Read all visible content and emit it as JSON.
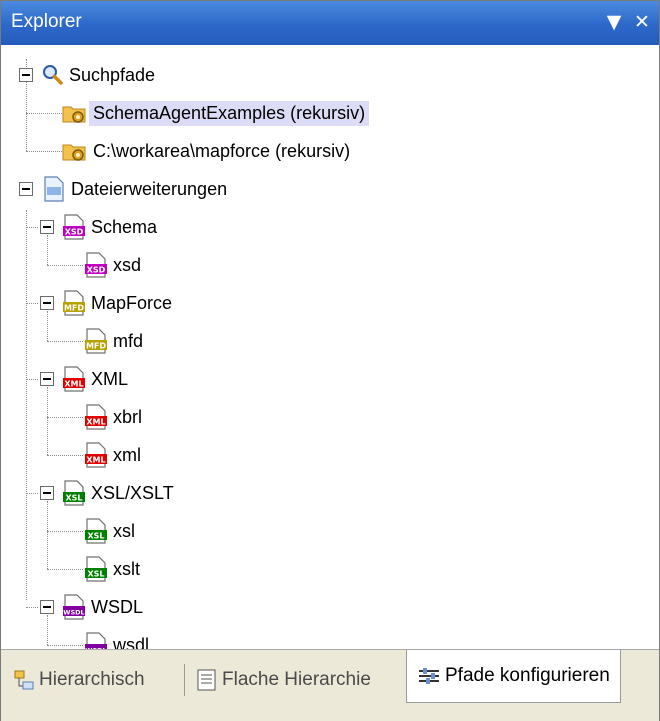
{
  "panel": {
    "title": "Explorer",
    "dropdown_icon": "triangle-down",
    "close_icon": "x"
  },
  "tree": {
    "suchpfade": {
      "label": "Suchpfade",
      "children": [
        {
          "label": "SchemaAgentExamples (rekursiv)",
          "selected": true
        },
        {
          "label": "C:\\workarea\\mapforce (rekursiv)",
          "selected": false
        }
      ]
    },
    "dateierweiterungen": {
      "label": "Dateierweiterungen",
      "groups": [
        {
          "label": "Schema",
          "badge": "XSD",
          "color": "#c000c0",
          "items": [
            "xsd"
          ]
        },
        {
          "label": "MapForce",
          "badge": "MFD",
          "color": "#b8a000",
          "items": [
            "mfd"
          ]
        },
        {
          "label": "XML",
          "badge": "XML",
          "color": "#e00000",
          "items": [
            "xbrl",
            "xml"
          ]
        },
        {
          "label": "XSL/XSLT",
          "badge": "XSL",
          "color": "#008000",
          "items": [
            "xsl",
            "xslt"
          ]
        },
        {
          "label": "WSDL",
          "badge": "WSDL",
          "color": "#8000a0",
          "items": [
            "wsdl"
          ]
        }
      ]
    }
  },
  "tabs": [
    {
      "label": "Hierarchisch",
      "active": false
    },
    {
      "label": "Flache Hierarchie",
      "active": false
    },
    {
      "label": "Pfade konfigurieren",
      "active": true
    }
  ]
}
